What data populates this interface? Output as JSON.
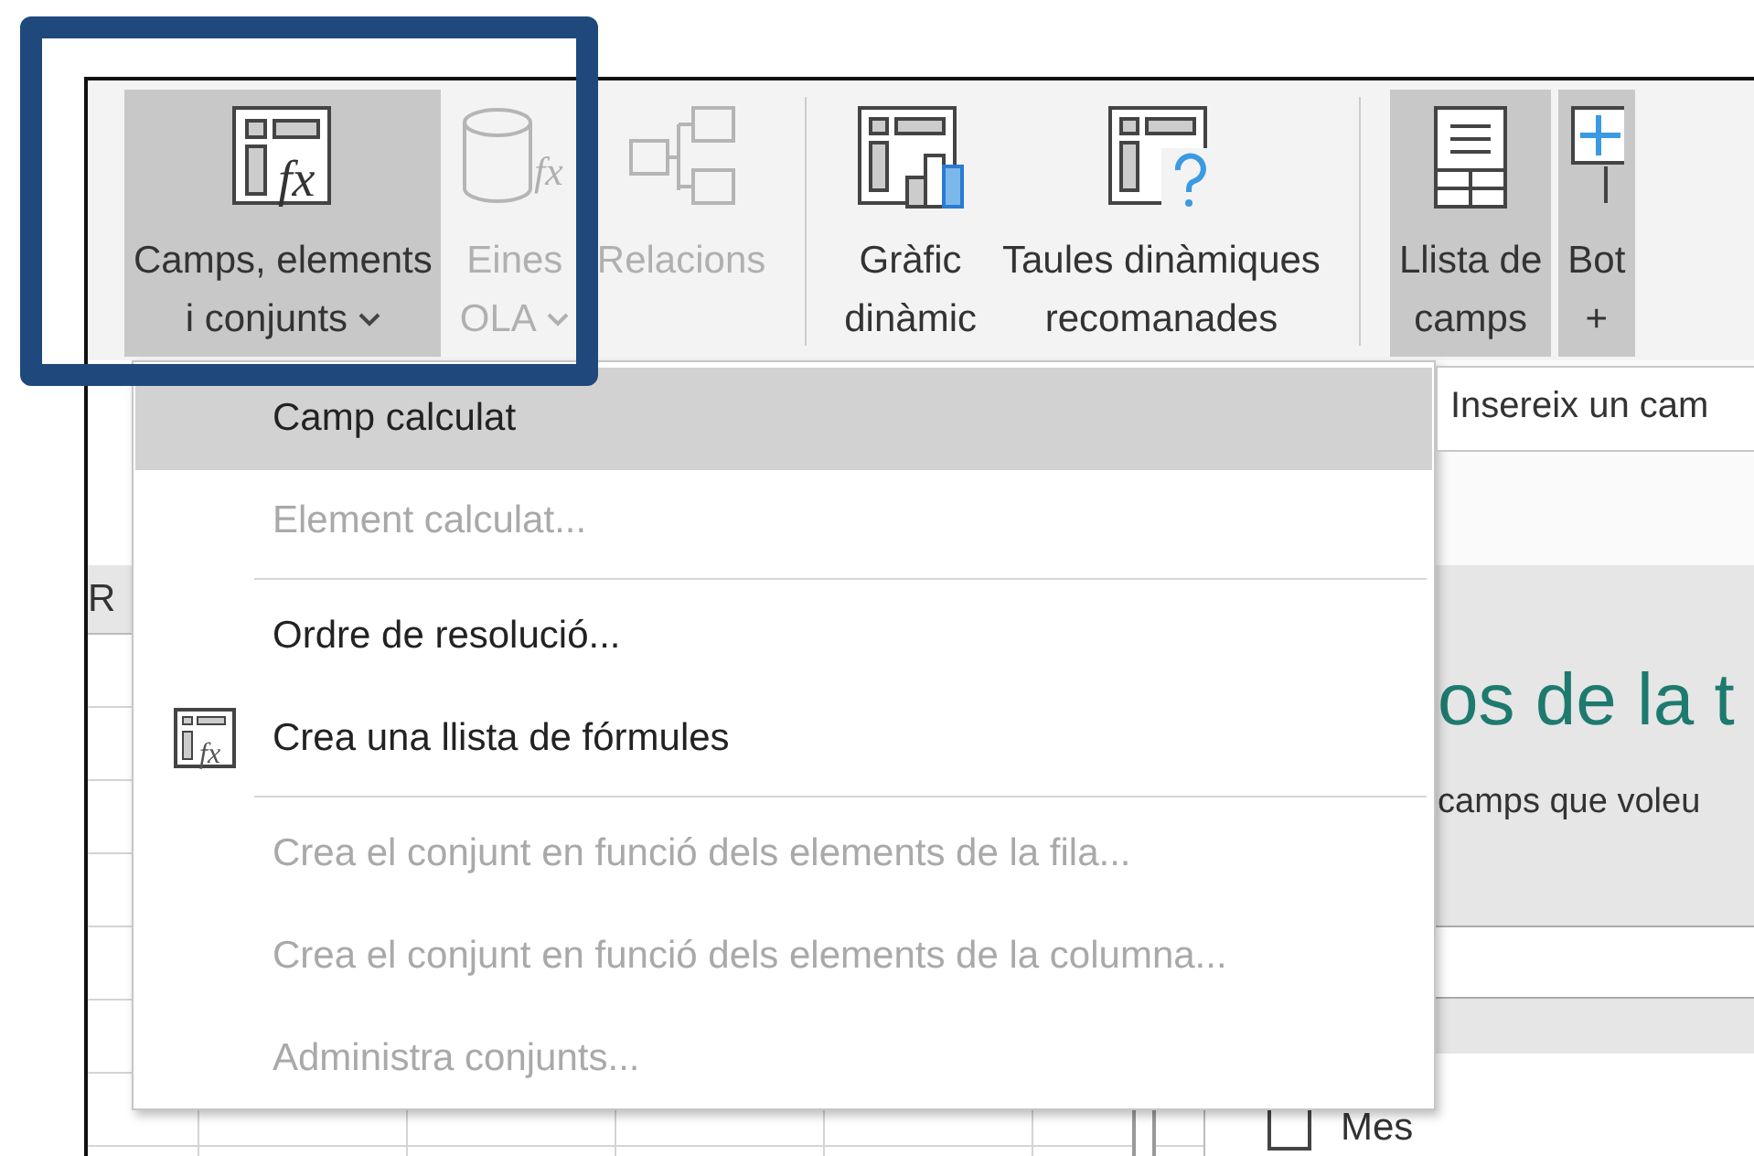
{
  "ribbon": {
    "groups": [
      {
        "buttons": [
          {
            "icon_text": "fx",
            "label": "Camps, elements\ni conjunts",
            "dropdown": true,
            "selected": true,
            "disabled": false
          },
          {
            "icon_text": "fx",
            "label": "Eines\nOLA",
            "dropdown": true,
            "selected": false,
            "disabled": true
          },
          {
            "label": "Relacions",
            "dropdown": false,
            "selected": false,
            "disabled": true
          }
        ]
      },
      {
        "buttons": [
          {
            "label": "Gràfic\ndinàmic",
            "dropdown": false,
            "selected": false,
            "disabled": false
          },
          {
            "label": "Taules dinàmiques\nrecomanades",
            "dropdown": false,
            "selected": false,
            "disabled": false
          }
        ]
      },
      {
        "buttons": [
          {
            "label": "Llista de\ncamps",
            "dropdown": false,
            "selected": true,
            "disabled": false
          },
          {
            "label": "Bot\n+",
            "dropdown": false,
            "selected": true,
            "disabled": false
          }
        ]
      }
    ]
  },
  "sheet": {
    "column_header": "R"
  },
  "pane": {
    "title": "os de la t",
    "subtitle": "camps que voleu",
    "fields": [
      {
        "label": "Mes",
        "checked": false
      }
    ]
  },
  "menu": {
    "items": [
      {
        "kind": "item",
        "label": "Camp calculat",
        "selected": true,
        "disabled": false
      },
      {
        "kind": "item",
        "label": "Element calculat...",
        "selected": false,
        "disabled": true
      },
      {
        "kind": "separator"
      },
      {
        "kind": "item",
        "label": "Ordre de resolució...",
        "selected": false,
        "disabled": false
      },
      {
        "kind": "icon_item",
        "icon_text": "fx",
        "label": "Crea una llista de fórmules",
        "selected": false,
        "disabled": false
      },
      {
        "kind": "separator"
      },
      {
        "kind": "item",
        "label": "Crea el conjunt en funció dels elements de la fila...",
        "selected": false,
        "disabled": true
      },
      {
        "kind": "item",
        "label": "Crea el conjunt en funció dels elements de la columna...",
        "selected": false,
        "disabled": true
      },
      {
        "kind": "item",
        "label": "Administra conjunts...",
        "selected": false,
        "disabled": true
      }
    ]
  },
  "tooltip": {
    "text": "Insereix un cam"
  }
}
